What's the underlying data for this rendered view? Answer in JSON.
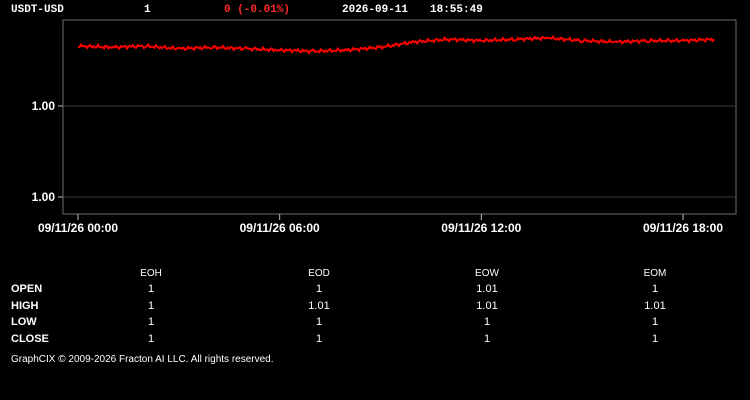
{
  "header": {
    "symbol": "USDT-USD",
    "value": "1",
    "change": "0 (-0.01%)",
    "date": "2026-09-11",
    "time": "18:55:49",
    "change_color": "#ff2a2a"
  },
  "chart_data": {
    "type": "line",
    "series": [
      {
        "color": "#ff0000",
        "x_hours": [
          0,
          1,
          2,
          3,
          4,
          5,
          6,
          7,
          8,
          9,
          10,
          11,
          12,
          13,
          14,
          15,
          16,
          17,
          18,
          18.93
        ],
        "y": [
          1.0118,
          1.0117,
          1.0118,
          1.0116,
          1.0117,
          1.0116,
          1.0115,
          1.0114,
          1.0115,
          1.0117,
          1.0121,
          1.0123,
          1.0122,
          1.0123,
          1.0124,
          1.0122,
          1.0121,
          1.0122,
          1.0122,
          1.0123
        ]
      }
    ],
    "xticks": [
      "09/11/26 00:00",
      "09/11/26 06:00",
      "09/11/26 12:00",
      "09/11/26 18:00"
    ],
    "yticks": [
      "1.00",
      "1.00"
    ],
    "grid": true
  },
  "stats": {
    "columns": [
      "EOH",
      "EOD",
      "EOW",
      "EOM"
    ],
    "rows": [
      {
        "label": "OPEN",
        "values": [
          "1",
          "1",
          "1.01",
          "1"
        ]
      },
      {
        "label": "HIGH",
        "values": [
          "1",
          "1.01",
          "1.01",
          "1.01"
        ]
      },
      {
        "label": "LOW",
        "values": [
          "1",
          "1",
          "1",
          "1"
        ]
      },
      {
        "label": "CLOSE",
        "values": [
          "1",
          "1",
          "1",
          "1"
        ]
      }
    ]
  },
  "footer": {
    "copyright": "GraphCIX © 2009-2026 Fracton AI LLC. All rights reserved."
  }
}
